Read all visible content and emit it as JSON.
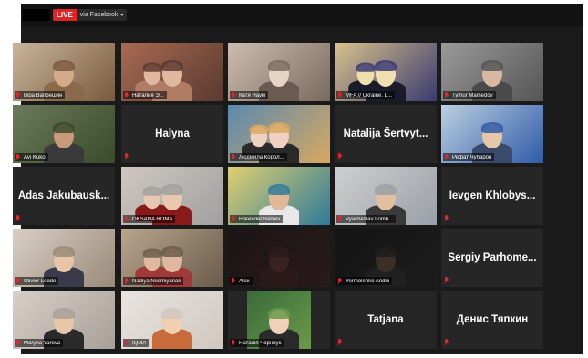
{
  "stream": {
    "live_label": "LIVE",
    "destination": "via Facebook",
    "caret": "▾"
  },
  "colors": {
    "tile_bg": "#262626",
    "active_border": "#b6e05a",
    "mic_muted": "#e5252a",
    "live_red": "#e02424"
  },
  "participants": [
    {
      "name": "Віра Вапрешин",
      "video": true
    },
    {
      "name": "Наталия Э...",
      "video": true
    },
    {
      "name": "Катя Наум",
      "video": true
    },
    {
      "name": "MFA // Ukraine, L...",
      "video": true
    },
    {
      "name": "Tymur Mamedov",
      "video": true
    },
    {
      "name": "Avi Kuko",
      "video": true
    },
    {
      "name": "Halyna",
      "video": false
    },
    {
      "name": "Людмила Корол...",
      "video": true
    },
    {
      "name": "Natalija Šertvyt...",
      "video": false
    },
    {
      "name": "Рефат Чубаров",
      "video": true,
      "active": true
    },
    {
      "name": "Adas Jakubausk...",
      "video": false
    },
    {
      "name": "OKSANA ROMA",
      "video": true
    },
    {
      "name": "Eskender Barliev",
      "video": true
    },
    {
      "name": "Vyacheslav Lomb...",
      "video": true
    },
    {
      "name": "Ievgen Khlobys...",
      "video": false
    },
    {
      "name": "Olivier Loode",
      "video": true
    },
    {
      "name": "Nadiya Nesmiyanak",
      "video": true
    },
    {
      "name": "Alex",
      "video": true
    },
    {
      "name": "Yermolenko Andrii",
      "video": true
    },
    {
      "name": "Sergiy Parhome...",
      "video": false
    },
    {
      "name": "Maryna Yarova",
      "video": true
    },
    {
      "name": "IQMA",
      "video": true
    },
    {
      "name": "Наталія Чорноус",
      "video": true
    },
    {
      "name": "Tatjana",
      "video": false
    },
    {
      "name": "Денис Тяпкин",
      "video": false
    }
  ]
}
